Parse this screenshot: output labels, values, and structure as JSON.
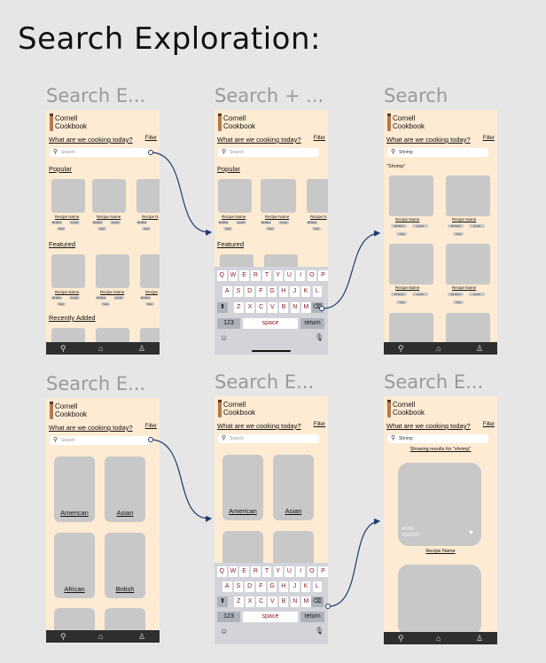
{
  "page_title": "Search Exploration:",
  "app": {
    "brand_line1": "Cornell",
    "brand_line2": "Cookbook",
    "prompt": "What are we cooking today?",
    "filter": "Filter",
    "search_placeholder": "Search"
  },
  "frames": {
    "f1": {
      "label": "Search E..."
    },
    "f2": {
      "label": "Search + ..."
    },
    "f3": {
      "label": "Search",
      "query": "Shrimp",
      "results_heading": "\"Shrimp\""
    },
    "f4": {
      "label": "Search E..."
    },
    "f5": {
      "label": "Search E..."
    },
    "f6": {
      "label": "Search E...",
      "query": "Shrimp",
      "showing": "Showing results for \"shrimp\"",
      "recipe": "Recipe Name"
    }
  },
  "sections": {
    "popular": "Popular",
    "featured": "Featured",
    "recent": "Recently Added"
  },
  "card": {
    "name": "Recipe Name",
    "name_cut": "Recipe N",
    "name_cut2": "Recipe",
    "tag1": "30 Mins",
    "tag2": "Lunch",
    "tag3": "Veg"
  },
  "categories": [
    "American",
    "Asian",
    "African",
    "British"
  ],
  "keyboard": {
    "row1": [
      "Q",
      "W",
      "E",
      "R",
      "T",
      "Y",
      "U",
      "I",
      "O",
      "P"
    ],
    "row2": [
      "A",
      "S",
      "D",
      "F",
      "G",
      "H",
      "J",
      "K",
      "L"
    ],
    "row3": [
      "Z",
      "X",
      "C",
      "V",
      "B",
      "N",
      "M"
    ],
    "numbers": "123",
    "space": "space",
    "return": "return"
  },
  "icons": {
    "search": "search-icon",
    "home": "home-icon",
    "profile": "profile-icon",
    "shift": "shift-icon",
    "backspace": "backspace-icon",
    "emoji": "emoji-icon",
    "mic": "mic-icon"
  }
}
